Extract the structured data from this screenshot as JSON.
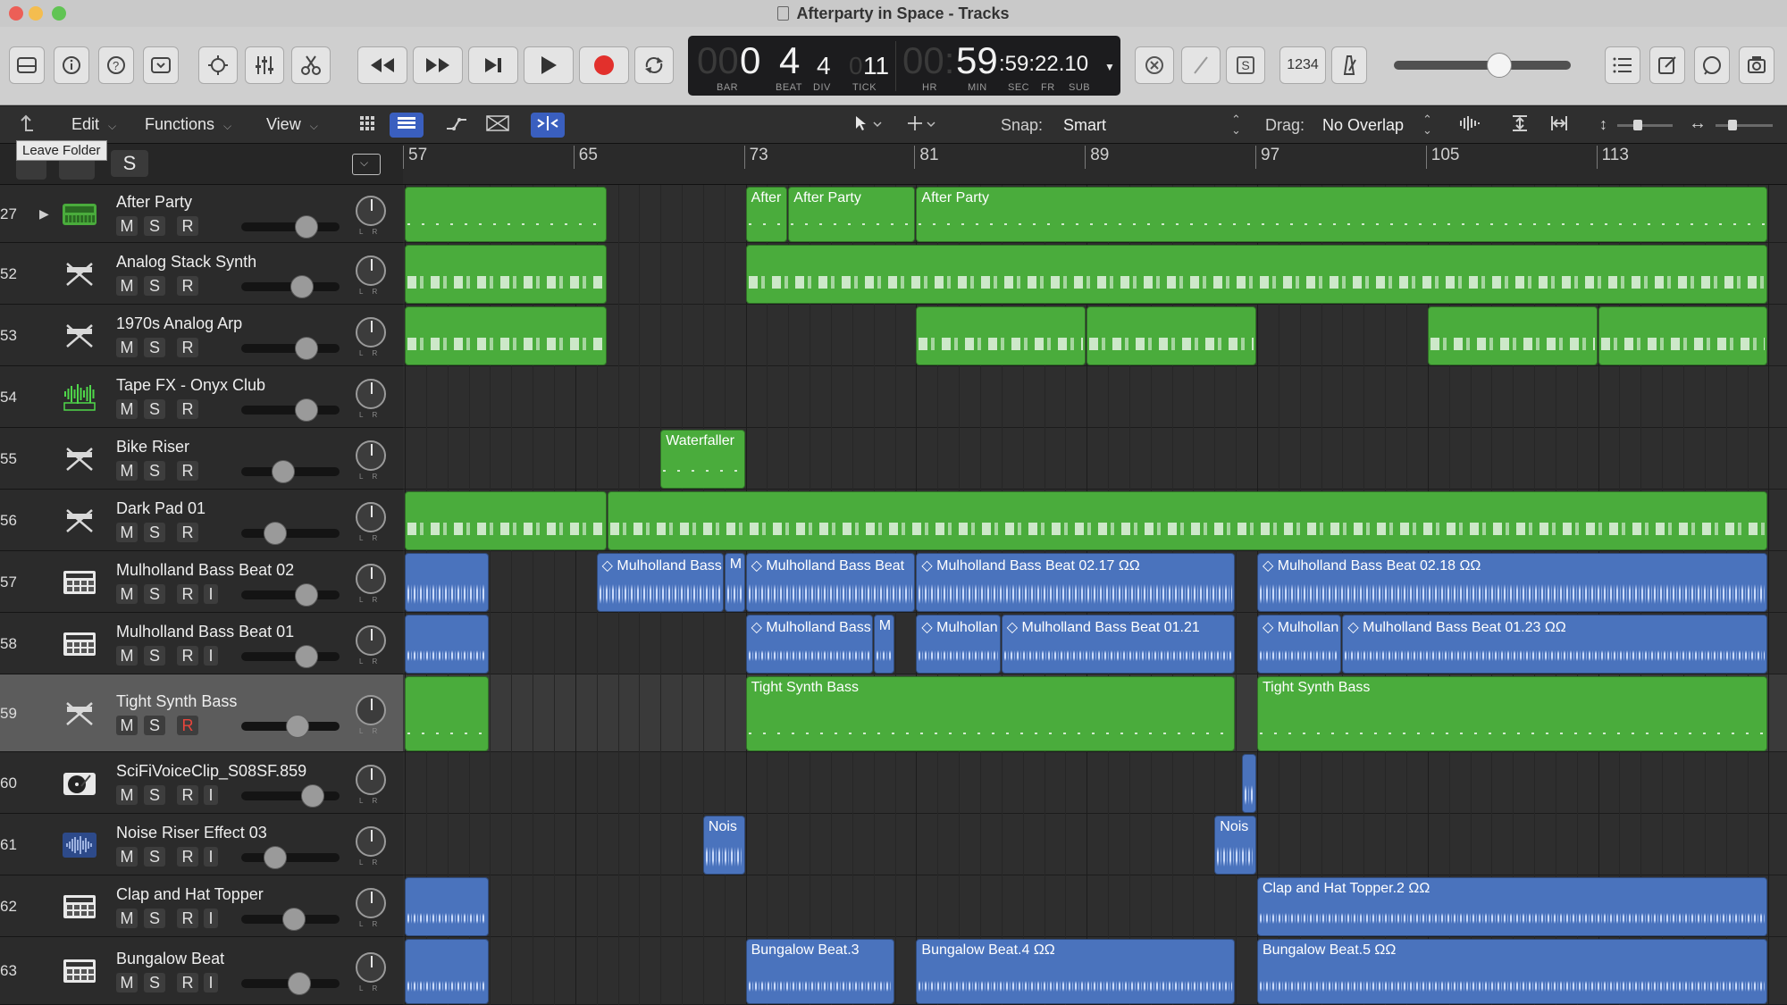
{
  "window": {
    "title": "Afterparty in Space - Tracks"
  },
  "lcd": {
    "bar_dim": "00",
    "bar": "0",
    "beat": "4",
    "div": "4",
    "tick_dim": "0",
    "tick": "11",
    "hr_dim": "00:",
    "min": "59",
    "sec_rest": ":59:22.10",
    "labels": {
      "bar": "BAR",
      "beat": "BEAT",
      "div": "DIV",
      "tick": "TICK",
      "hr": "HR",
      "min": "MIN",
      "sec": "SEC",
      "fr": "FR",
      "sub": "SUB"
    }
  },
  "control_bar": {
    "count_in_label": "1234",
    "solo_label": "S",
    "volume_level": 0.62
  },
  "edit_toolbar": {
    "edit_menu": "Edit",
    "functions_menu": "Functions",
    "view_menu": "View",
    "snap_label": "Snap:",
    "snap_value": "Smart",
    "drag_label": "Drag:",
    "drag_value": "No Overlap"
  },
  "tooltip": {
    "leave_folder": "Leave Folder"
  },
  "track_header": {
    "global_solo": "S"
  },
  "ruler": {
    "bars": [
      "57",
      "65",
      "73",
      "81",
      "89",
      "97",
      "105",
      "113"
    ]
  },
  "buttons": {
    "mute": "M",
    "solo": "S",
    "record": "R",
    "input": "I",
    "pan_lr": "LR"
  },
  "tracks": [
    {
      "number": "27",
      "name": "After Party",
      "icon": "drum-machine-icon",
      "fader": 0.72,
      "has_input": false,
      "record_armed": false,
      "selected": false,
      "kind": "folder"
    },
    {
      "number": "52",
      "name": "Analog Stack Synth",
      "icon": "synth-stand-icon",
      "fader": 0.65,
      "has_input": false,
      "record_armed": false,
      "selected": false
    },
    {
      "number": "53",
      "name": "1970s Analog Arp",
      "icon": "synth-stand-icon",
      "fader": 0.72,
      "has_input": false,
      "record_armed": false,
      "selected": false
    },
    {
      "number": "54",
      "name": "Tape FX - Onyx Club",
      "icon": "waveform-fx-icon",
      "fader": 0.72,
      "has_input": false,
      "record_armed": false,
      "selected": false
    },
    {
      "number": "55",
      "name": "Bike Riser",
      "icon": "synth-stand-icon",
      "fader": 0.4,
      "has_input": false,
      "record_armed": false,
      "selected": false
    },
    {
      "number": "56",
      "name": "Dark Pad 01",
      "icon": "synth-stand-icon",
      "fader": 0.3,
      "has_input": false,
      "record_armed": false,
      "selected": false
    },
    {
      "number": "57",
      "name": "Mulholland Bass Beat 02",
      "icon": "drum-pad-icon",
      "fader": 0.72,
      "has_input": true,
      "record_armed": false,
      "selected": false
    },
    {
      "number": "58",
      "name": "Mulholland Bass Beat 01",
      "icon": "drum-pad-icon",
      "fader": 0.72,
      "has_input": true,
      "record_armed": false,
      "selected": false
    },
    {
      "number": "59",
      "name": "Tight Synth Bass",
      "icon": "synth-stand-icon",
      "fader": 0.6,
      "has_input": false,
      "record_armed": true,
      "selected": true
    },
    {
      "number": "60",
      "name": "SciFiVoiceClip_S08SF.859",
      "icon": "turntable-icon",
      "fader": 0.8,
      "has_input": true,
      "record_armed": false,
      "selected": false
    },
    {
      "number": "61",
      "name": "Noise Riser Effect 03",
      "icon": "waveform-icon",
      "fader": 0.3,
      "has_input": true,
      "record_armed": false,
      "selected": false
    },
    {
      "number": "62",
      "name": "Clap and Hat Topper",
      "icon": "drum-pad-icon",
      "fader": 0.55,
      "has_input": true,
      "record_armed": false,
      "selected": false
    },
    {
      "number": "63",
      "name": "Bungalow Beat",
      "icon": "drum-pad-icon",
      "fader": 0.62,
      "has_input": true,
      "record_armed": false,
      "selected": false
    }
  ],
  "regions": [
    {
      "track": 0,
      "type": "midi",
      "start": 57,
      "end": 66.5,
      "label": ""
    },
    {
      "track": 0,
      "type": "midi",
      "start": 73,
      "end": 75,
      "label": "After"
    },
    {
      "track": 0,
      "type": "midi",
      "start": 75,
      "end": 81,
      "label": "After Party"
    },
    {
      "track": 0,
      "type": "midi",
      "start": 81,
      "end": 121,
      "label": "After Party"
    },
    {
      "track": 1,
      "type": "midi",
      "start": 57,
      "end": 66.5,
      "label": ""
    },
    {
      "track": 1,
      "type": "midi",
      "start": 73,
      "end": 121,
      "label": ""
    },
    {
      "track": 2,
      "type": "midi",
      "start": 57,
      "end": 66.5,
      "label": ""
    },
    {
      "track": 2,
      "type": "midi",
      "start": 81,
      "end": 89,
      "label": ""
    },
    {
      "track": 2,
      "type": "midi",
      "start": 89,
      "end": 97,
      "label": ""
    },
    {
      "track": 2,
      "type": "midi",
      "start": 105,
      "end": 113,
      "label": ""
    },
    {
      "track": 2,
      "type": "midi",
      "start": 113,
      "end": 121,
      "label": ""
    },
    {
      "track": 4,
      "type": "midi",
      "start": 69,
      "end": 73,
      "label": "Waterfaller"
    },
    {
      "track": 5,
      "type": "midi",
      "start": 57,
      "end": 66.5,
      "label": ""
    },
    {
      "track": 5,
      "type": "midi",
      "start": 66.5,
      "end": 121,
      "label": ""
    },
    {
      "track": 6,
      "type": "audio",
      "start": 57,
      "end": 61,
      "label": ""
    },
    {
      "track": 6,
      "type": "audio",
      "start": 66,
      "end": 72,
      "label": "◇ Mulholland Bass"
    },
    {
      "track": 6,
      "type": "audio",
      "start": 72,
      "end": 73,
      "label": "M"
    },
    {
      "track": 6,
      "type": "audio",
      "start": 73,
      "end": 81,
      "label": "◇ Mulholland Bass Beat"
    },
    {
      "track": 6,
      "type": "audio",
      "start": 81,
      "end": 96,
      "label": "◇ Mulholland Bass Beat 02.17  ΩΩ"
    },
    {
      "track": 6,
      "type": "audio",
      "start": 97,
      "end": 121,
      "label": "◇ Mulholland Bass Beat 02.18  ΩΩ"
    },
    {
      "track": 7,
      "type": "audio",
      "start": 57,
      "end": 61,
      "label": ""
    },
    {
      "track": 7,
      "type": "audio",
      "start": 73,
      "end": 79,
      "label": "◇ Mulholland Bass"
    },
    {
      "track": 7,
      "type": "audio",
      "start": 79,
      "end": 80,
      "label": "M"
    },
    {
      "track": 7,
      "type": "audio",
      "start": 81,
      "end": 85,
      "label": "◇ Mulhollan"
    },
    {
      "track": 7,
      "type": "audio",
      "start": 85,
      "end": 96,
      "label": "◇ Mulholland Bass Beat 01.21"
    },
    {
      "track": 7,
      "type": "audio",
      "start": 97,
      "end": 101,
      "label": "◇ Mulhollan"
    },
    {
      "track": 7,
      "type": "audio",
      "start": 101,
      "end": 121,
      "label": "◇ Mulholland Bass Beat 01.23  ΩΩ"
    },
    {
      "track": 8,
      "type": "midi",
      "start": 57,
      "end": 61,
      "label": ""
    },
    {
      "track": 8,
      "type": "midi",
      "start": 73,
      "end": 96,
      "label": "Tight Synth Bass"
    },
    {
      "track": 8,
      "type": "midi",
      "start": 97,
      "end": 121,
      "label": "Tight Synth Bass"
    },
    {
      "track": 9,
      "type": "audio",
      "start": 96.3,
      "end": 97,
      "label": ""
    },
    {
      "track": 10,
      "type": "audio",
      "start": 71,
      "end": 73,
      "label": "Nois"
    },
    {
      "track": 10,
      "type": "audio",
      "start": 95,
      "end": 97,
      "label": "Nois"
    },
    {
      "track": 11,
      "type": "audio",
      "start": 57,
      "end": 61,
      "label": ""
    },
    {
      "track": 11,
      "type": "audio",
      "start": 97,
      "end": 121,
      "label": "Clap and Hat Topper.2  ΩΩ"
    },
    {
      "track": 12,
      "type": "audio",
      "start": 57,
      "end": 61,
      "label": ""
    },
    {
      "track": 12,
      "type": "audio",
      "start": 73,
      "end": 80,
      "label": "Bungalow Beat.3"
    },
    {
      "track": 12,
      "type": "audio",
      "start": 81,
      "end": 96,
      "label": "Bungalow Beat.4  ΩΩ"
    },
    {
      "track": 12,
      "type": "audio",
      "start": 97,
      "end": 121,
      "label": "Bungalow Beat.5  ΩΩ"
    }
  ]
}
